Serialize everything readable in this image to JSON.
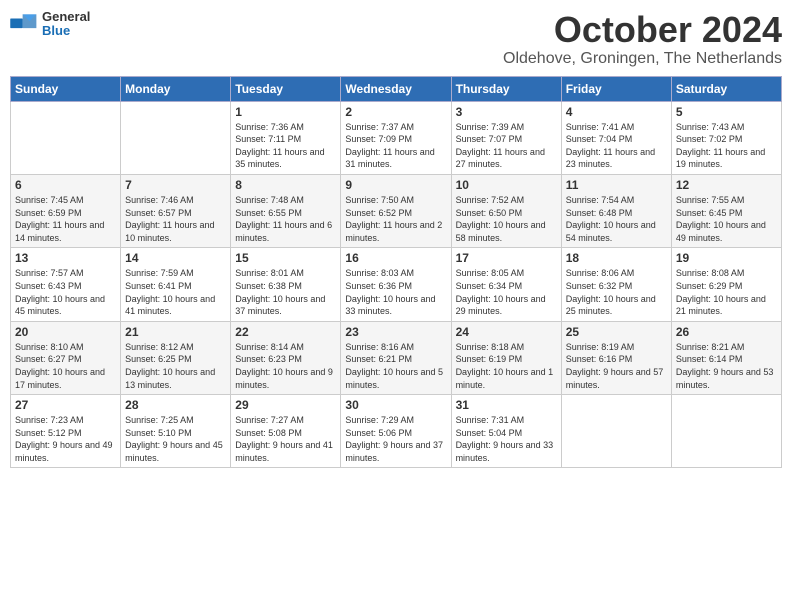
{
  "header": {
    "logo_general": "General",
    "logo_blue": "Blue",
    "month_title": "October 2024",
    "location": "Oldehove, Groningen, The Netherlands"
  },
  "calendar": {
    "days_of_week": [
      "Sunday",
      "Monday",
      "Tuesday",
      "Wednesday",
      "Thursday",
      "Friday",
      "Saturday"
    ],
    "weeks": [
      [
        {
          "day": "",
          "info": ""
        },
        {
          "day": "",
          "info": ""
        },
        {
          "day": "1",
          "info": "Sunrise: 7:36 AM\nSunset: 7:11 PM\nDaylight: 11 hours and 35 minutes."
        },
        {
          "day": "2",
          "info": "Sunrise: 7:37 AM\nSunset: 7:09 PM\nDaylight: 11 hours and 31 minutes."
        },
        {
          "day": "3",
          "info": "Sunrise: 7:39 AM\nSunset: 7:07 PM\nDaylight: 11 hours and 27 minutes."
        },
        {
          "day": "4",
          "info": "Sunrise: 7:41 AM\nSunset: 7:04 PM\nDaylight: 11 hours and 23 minutes."
        },
        {
          "day": "5",
          "info": "Sunrise: 7:43 AM\nSunset: 7:02 PM\nDaylight: 11 hours and 19 minutes."
        }
      ],
      [
        {
          "day": "6",
          "info": "Sunrise: 7:45 AM\nSunset: 6:59 PM\nDaylight: 11 hours and 14 minutes."
        },
        {
          "day": "7",
          "info": "Sunrise: 7:46 AM\nSunset: 6:57 PM\nDaylight: 11 hours and 10 minutes."
        },
        {
          "day": "8",
          "info": "Sunrise: 7:48 AM\nSunset: 6:55 PM\nDaylight: 11 hours and 6 minutes."
        },
        {
          "day": "9",
          "info": "Sunrise: 7:50 AM\nSunset: 6:52 PM\nDaylight: 11 hours and 2 minutes."
        },
        {
          "day": "10",
          "info": "Sunrise: 7:52 AM\nSunset: 6:50 PM\nDaylight: 10 hours and 58 minutes."
        },
        {
          "day": "11",
          "info": "Sunrise: 7:54 AM\nSunset: 6:48 PM\nDaylight: 10 hours and 54 minutes."
        },
        {
          "day": "12",
          "info": "Sunrise: 7:55 AM\nSunset: 6:45 PM\nDaylight: 10 hours and 49 minutes."
        }
      ],
      [
        {
          "day": "13",
          "info": "Sunrise: 7:57 AM\nSunset: 6:43 PM\nDaylight: 10 hours and 45 minutes."
        },
        {
          "day": "14",
          "info": "Sunrise: 7:59 AM\nSunset: 6:41 PM\nDaylight: 10 hours and 41 minutes."
        },
        {
          "day": "15",
          "info": "Sunrise: 8:01 AM\nSunset: 6:38 PM\nDaylight: 10 hours and 37 minutes."
        },
        {
          "day": "16",
          "info": "Sunrise: 8:03 AM\nSunset: 6:36 PM\nDaylight: 10 hours and 33 minutes."
        },
        {
          "day": "17",
          "info": "Sunrise: 8:05 AM\nSunset: 6:34 PM\nDaylight: 10 hours and 29 minutes."
        },
        {
          "day": "18",
          "info": "Sunrise: 8:06 AM\nSunset: 6:32 PM\nDaylight: 10 hours and 25 minutes."
        },
        {
          "day": "19",
          "info": "Sunrise: 8:08 AM\nSunset: 6:29 PM\nDaylight: 10 hours and 21 minutes."
        }
      ],
      [
        {
          "day": "20",
          "info": "Sunrise: 8:10 AM\nSunset: 6:27 PM\nDaylight: 10 hours and 17 minutes."
        },
        {
          "day": "21",
          "info": "Sunrise: 8:12 AM\nSunset: 6:25 PM\nDaylight: 10 hours and 13 minutes."
        },
        {
          "day": "22",
          "info": "Sunrise: 8:14 AM\nSunset: 6:23 PM\nDaylight: 10 hours and 9 minutes."
        },
        {
          "day": "23",
          "info": "Sunrise: 8:16 AM\nSunset: 6:21 PM\nDaylight: 10 hours and 5 minutes."
        },
        {
          "day": "24",
          "info": "Sunrise: 8:18 AM\nSunset: 6:19 PM\nDaylight: 10 hours and 1 minute."
        },
        {
          "day": "25",
          "info": "Sunrise: 8:19 AM\nSunset: 6:16 PM\nDaylight: 9 hours and 57 minutes."
        },
        {
          "day": "26",
          "info": "Sunrise: 8:21 AM\nSunset: 6:14 PM\nDaylight: 9 hours and 53 minutes."
        }
      ],
      [
        {
          "day": "27",
          "info": "Sunrise: 7:23 AM\nSunset: 5:12 PM\nDaylight: 9 hours and 49 minutes."
        },
        {
          "day": "28",
          "info": "Sunrise: 7:25 AM\nSunset: 5:10 PM\nDaylight: 9 hours and 45 minutes."
        },
        {
          "day": "29",
          "info": "Sunrise: 7:27 AM\nSunset: 5:08 PM\nDaylight: 9 hours and 41 minutes."
        },
        {
          "day": "30",
          "info": "Sunrise: 7:29 AM\nSunset: 5:06 PM\nDaylight: 9 hours and 37 minutes."
        },
        {
          "day": "31",
          "info": "Sunrise: 7:31 AM\nSunset: 5:04 PM\nDaylight: 9 hours and 33 minutes."
        },
        {
          "day": "",
          "info": ""
        },
        {
          "day": "",
          "info": ""
        }
      ]
    ]
  }
}
